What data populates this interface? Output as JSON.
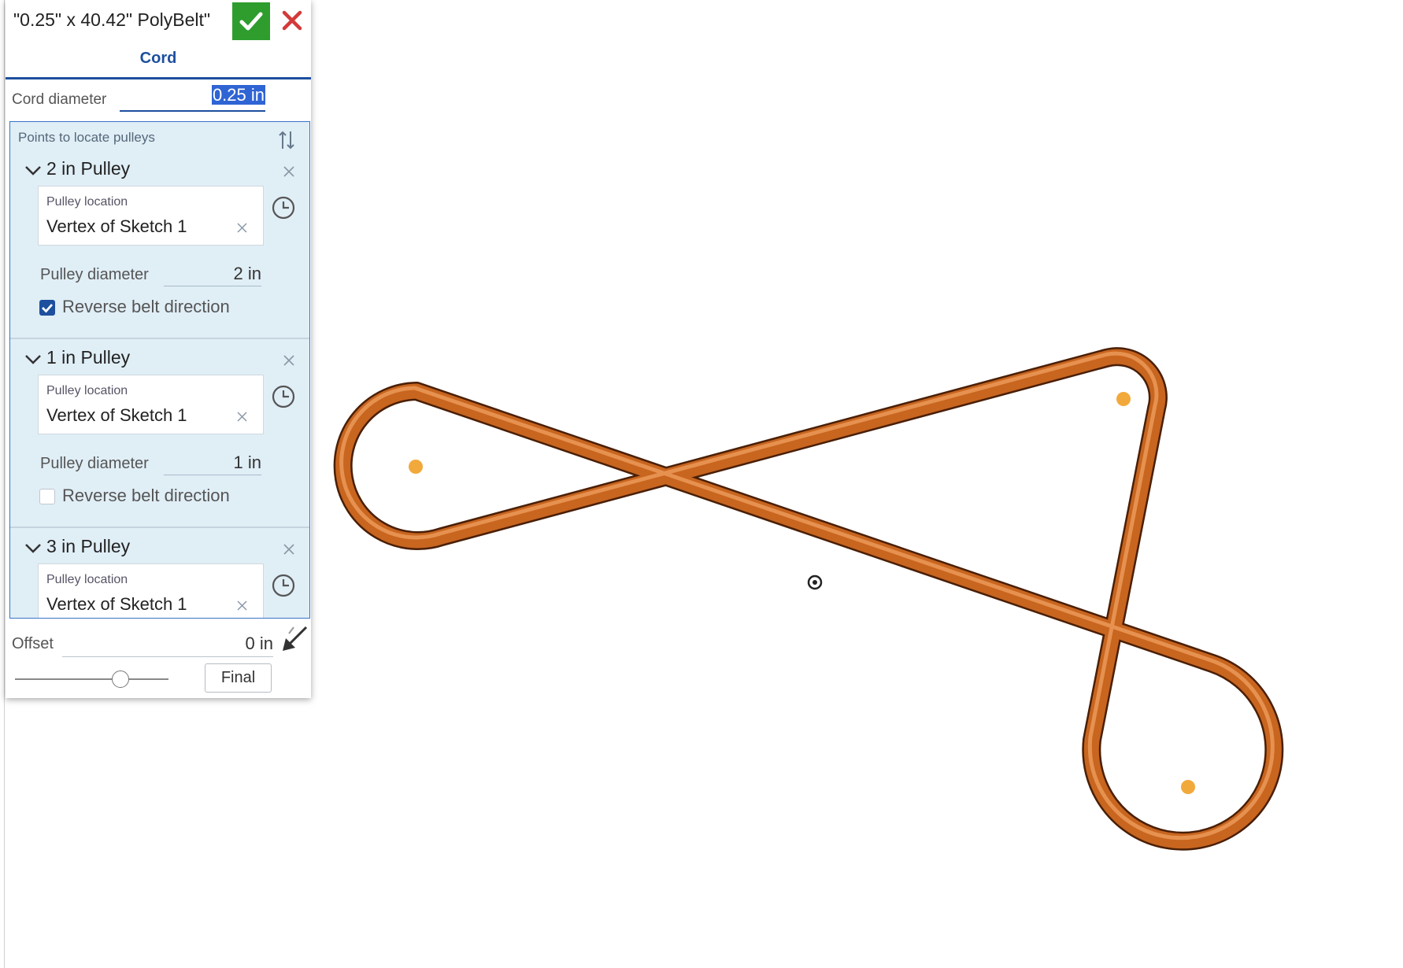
{
  "feature": {
    "title": "\"0.25\" x 40.42\" PolyBelt\"",
    "accent_color": "#2e9d2e",
    "cancel_color": "#d33a3a",
    "ok_icon": "check-icon",
    "cancel_icon": "close-icon"
  },
  "tabs": [
    {
      "label": "Cord",
      "active": true
    }
  ],
  "cord": {
    "label": "Cord diameter",
    "value": "0.25 in"
  },
  "points": {
    "title": "Points to locate pulleys",
    "pulleys": [
      {
        "name": "2 in Pulley",
        "location_label": "Pulley location",
        "location_value": "Vertex of Sketch 1",
        "diameter_label": "Pulley diameter",
        "diameter_value": "2 in",
        "reverse_label": "Reverse belt direction",
        "reverse_checked": true
      },
      {
        "name": "1 in Pulley",
        "location_label": "Pulley location",
        "location_value": "Vertex of Sketch 1",
        "diameter_label": "Pulley diameter",
        "diameter_value": "1 in",
        "reverse_label": "Reverse belt direction",
        "reverse_checked": false
      },
      {
        "name": "3 in Pulley",
        "location_label": "Pulley location",
        "location_value": "Vertex of Sketch 1"
      }
    ]
  },
  "offset": {
    "label": "Offset",
    "value": "0 in"
  },
  "preview": {
    "slider_fraction": 0.68,
    "button_label": "Final"
  },
  "viewport": {
    "belt_color": "#c8651f",
    "pulley_point_color": "#f2a93b",
    "origin_icon": "origin-icon"
  }
}
